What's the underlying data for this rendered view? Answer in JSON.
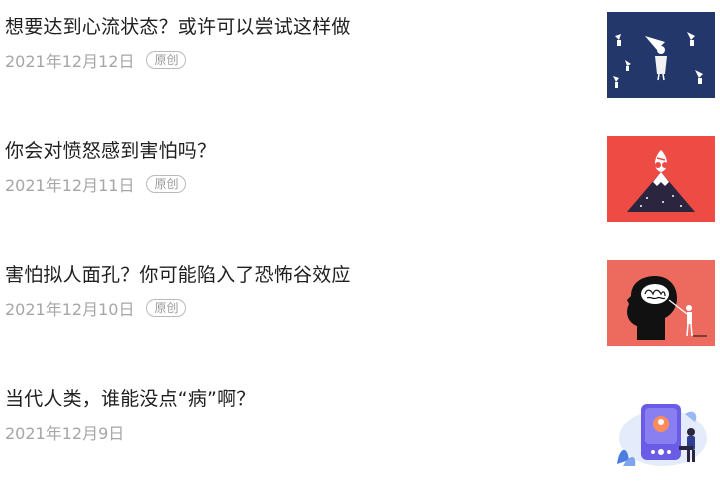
{
  "articles": [
    {
      "title": "想要达到心流状态？或许可以尝试这样做",
      "date": "2021年12月12日",
      "badge": "原创",
      "thumbnail_icon": "flying-figures-illustration",
      "thumbnail_color": "#23376b"
    },
    {
      "title": "你会对愤怒感到害怕吗？",
      "date": "2021年12月11日",
      "badge": "原创",
      "thumbnail_icon": "erupting-volcano-illustration",
      "thumbnail_color": "#ef4b45"
    },
    {
      "title": "害怕拟人面孔？你可能陷入了恐怖谷效应",
      "date": "2021年12月10日",
      "badge": "原创",
      "thumbnail_icon": "head-silhouette-brain-illustration",
      "thumbnail_color": "#ec6b5e"
    },
    {
      "title": "当代人类，谁能没点“病”啊？",
      "date": "2021年12月9日",
      "badge": "",
      "thumbnail_icon": "phone-music-player-illustration",
      "thumbnail_color": "#ffffff"
    }
  ]
}
